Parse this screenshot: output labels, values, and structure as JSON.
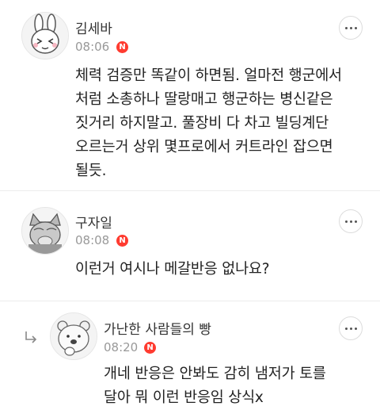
{
  "comments": [
    {
      "author": "김세바",
      "time": "08:06",
      "badge": "N",
      "avatar": "rabbit-avatar",
      "text": "체력 검증만 똑같이 하면됨. 얼마전 행군에서 처럼 소총하나 딸랑매고 행군하는 병신같은 짓거리 하지말고. 풀장비 다 차고 빌딩계단 오르는거 상위 몇프로에서 커트라인 잡으면 될듯."
    },
    {
      "author": "구자일",
      "time": "08:08",
      "badge": "N",
      "avatar": "cat-avatar",
      "text": "이런거 여시나 메갈반응 없나요?"
    },
    {
      "author": "가난한 사람들의 빵",
      "time": "08:20",
      "badge": "N",
      "avatar": "bear-avatar",
      "is_reply": true,
      "text": "개네 반응은 안봐도 감히 냄저가 토를 달아 뭐 이런 반응임 상식x"
    }
  ],
  "icons": {
    "more": "more-horizontal-icon",
    "reply": "reply-arrow-icon"
  },
  "colors": {
    "badge": "#ff3b30",
    "meta": "#999999",
    "text": "#222222"
  }
}
